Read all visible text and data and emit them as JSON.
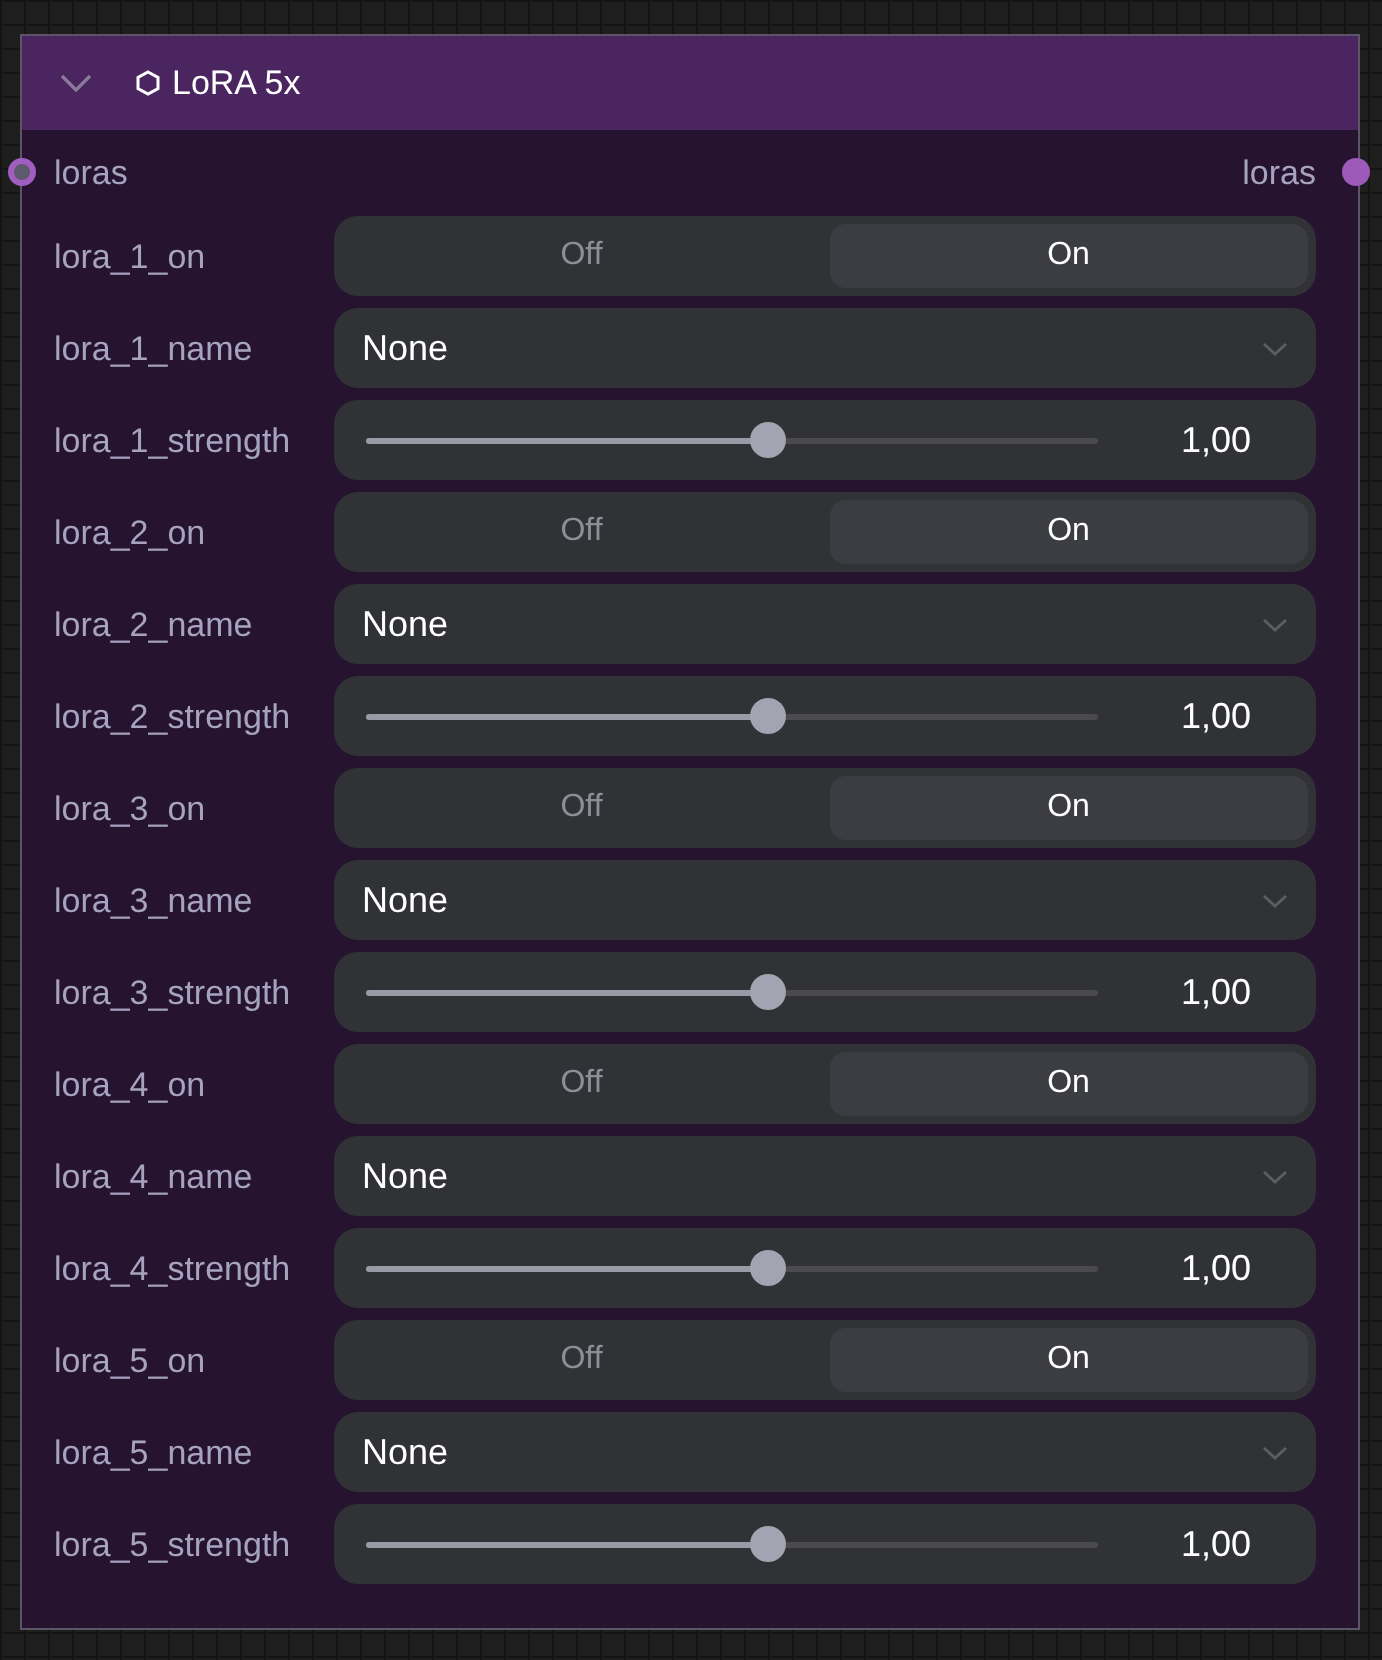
{
  "node": {
    "title": "LoRA 5x",
    "expanded": true,
    "inputs": [
      {
        "label": "loras",
        "connected": false
      }
    ],
    "outputs": [
      {
        "label": "loras",
        "connected": true
      }
    ],
    "widgets": [
      {
        "kind": "toggle",
        "label": "lora_1_on",
        "options": [
          {
            "label": "Off",
            "selected": false
          },
          {
            "label": "On",
            "selected": true
          }
        ]
      },
      {
        "kind": "combo",
        "label": "lora_1_name",
        "value": "None"
      },
      {
        "kind": "slider",
        "label": "lora_1_strength",
        "level": 0.55,
        "value": "1,00"
      },
      {
        "kind": "toggle",
        "label": "lora_2_on",
        "options": [
          {
            "label": "Off",
            "selected": false
          },
          {
            "label": "On",
            "selected": true
          }
        ]
      },
      {
        "kind": "combo",
        "label": "lora_2_name",
        "value": "None"
      },
      {
        "kind": "slider",
        "label": "lora_2_strength",
        "level": 0.55,
        "value": "1,00"
      },
      {
        "kind": "toggle",
        "label": "lora_3_on",
        "options": [
          {
            "label": "Off",
            "selected": false
          },
          {
            "label": "On",
            "selected": true
          }
        ]
      },
      {
        "kind": "combo",
        "label": "lora_3_name",
        "value": "None"
      },
      {
        "kind": "slider",
        "label": "lora_3_strength",
        "level": 0.55,
        "value": "1,00"
      },
      {
        "kind": "toggle",
        "label": "lora_4_on",
        "options": [
          {
            "label": "Off",
            "selected": false
          },
          {
            "label": "On",
            "selected": true
          }
        ]
      },
      {
        "kind": "combo",
        "label": "lora_4_name",
        "value": "None"
      },
      {
        "kind": "slider",
        "label": "lora_4_strength",
        "level": 0.55,
        "value": "1,00"
      },
      {
        "kind": "toggle",
        "label": "lora_5_on",
        "options": [
          {
            "label": "Off",
            "selected": false
          },
          {
            "label": "On",
            "selected": true
          }
        ]
      },
      {
        "kind": "combo",
        "label": "lora_5_name",
        "value": "None"
      },
      {
        "kind": "slider",
        "label": "lora_5_strength",
        "level": 0.55,
        "value": "1,00"
      }
    ]
  }
}
